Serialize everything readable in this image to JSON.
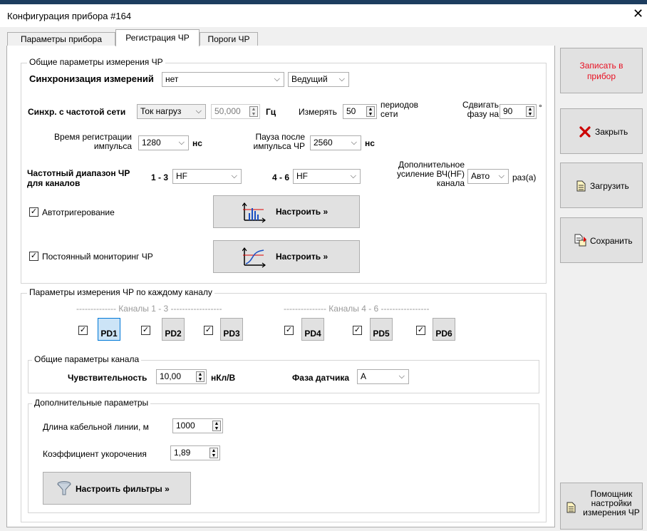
{
  "window": {
    "title": "Конфигурация прибора #164",
    "close_glyph": "✕"
  },
  "tabs": [
    {
      "label": "Параметры прибора"
    },
    {
      "label": "Регистрация ЧР"
    },
    {
      "label": "Пороги ЧР"
    }
  ],
  "general": {
    "group_label": "Общие параметры измерения ЧР",
    "sync_label": "Синхронизация измерений",
    "sync_value": "нет",
    "sync_role_value": "Ведущий",
    "netsync_label": "Синхр. с частотой сети",
    "netsync_source_value": "Ток нагруз",
    "netsync_freq_value": "50,000",
    "netsync_freq_unit": "Гц",
    "measure_label": "Измерять",
    "measure_value": "50",
    "measure_unit_1": "периодов",
    "measure_unit_2": "сети",
    "shift_label_1": "Сдвигать",
    "shift_label_2": "фазу на",
    "shift_value": "90",
    "shift_unit": "°",
    "pulse_time_label_1": "Время регистрации",
    "pulse_time_label_2": "импульса",
    "pulse_time_value": "1280",
    "pulse_time_unit": "нс",
    "pause_label_1": "Пауза после",
    "pause_label_2": "импульса ЧР",
    "pause_value": "2560",
    "pause_unit": "нс",
    "freq_range_label_1": "Частотный диапазон ЧР",
    "freq_range_label_2": "для каналов",
    "range_13_label": "1 - 3",
    "range_13_value": "HF",
    "range_46_label": "4 - 6",
    "range_46_value": "HF",
    "gain_label_1": "Дополнительное",
    "gain_label_2": "усиление ВЧ(HF)",
    "gain_label_3": "канала",
    "gain_value": "Авто",
    "gain_unit": "раз(а)",
    "autotrigger_label": "Автотригерование",
    "autotrigger_checked": "✓",
    "autotrigger_button": "Настроить »",
    "monitoring_label": "Постоянный мониторинг ЧР",
    "monitoring_checked": "✓",
    "monitoring_button": "Настроить »"
  },
  "per_channel": {
    "group_label": "Параметры измерения ЧР по каждому каналу",
    "channels_13_label": "-------------- Каналы 1 - 3 ------------------",
    "channels_46_label": "--------------- Каналы 4 - 6 -----------------",
    "channels": [
      {
        "label": "PD1",
        "checked": "✓",
        "selected": true
      },
      {
        "label": "PD2",
        "checked": "✓",
        "selected": false
      },
      {
        "label": "PD3",
        "checked": "✓",
        "selected": false
      },
      {
        "label": "PD4",
        "checked": "✓",
        "selected": false
      },
      {
        "label": "PD5",
        "checked": "✓",
        "selected": false
      },
      {
        "label": "PD6",
        "checked": "✓",
        "selected": false
      }
    ],
    "common_group_label": "Общие параметры канала",
    "sensitivity_label": "Чувствительность",
    "sensitivity_value": "10,00",
    "sensitivity_unit": "нКл/В",
    "phase_label": "Фаза датчика",
    "phase_value": "A",
    "extra_group_label": "Дополнительные параметры",
    "cable_label": "Длина кабельной линии, м",
    "cable_value": "1000",
    "shortening_label": "Коэффициент укорочения",
    "shortening_value": "1,89",
    "filters_button": "Настроить фильтры »"
  },
  "side": {
    "write_line1": "Записать в",
    "write_line2": "прибор",
    "write_color": "#e81123",
    "close_label": "Закрыть",
    "load_label": "Загрузить",
    "save_label": "Сохранить",
    "helper_line1": "Помощник",
    "helper_line2": "настройки",
    "helper_line3": "измерения ЧР"
  },
  "icons": {
    "chevron": "⌵",
    "spin_up": "▲",
    "spin_down": "▼"
  }
}
